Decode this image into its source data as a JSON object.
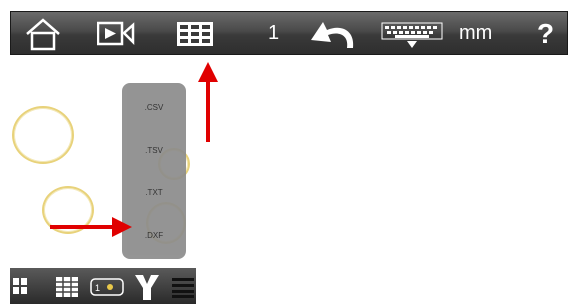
{
  "toolbar": {
    "page_number": "1",
    "units": "mm",
    "help_label": "?"
  },
  "export_menu": {
    "items": [
      ".CSV",
      ".TSV",
      ".TXT",
      ".DXF"
    ]
  },
  "colors": {
    "toolbar_bg": "#3a3a3a",
    "arrow": "#e00000",
    "circle_stroke": "#e8d27a",
    "panel_bg": "#8c8c8c"
  },
  "icons": [
    "home-icon",
    "video-camera-icon",
    "table-icon",
    "undo-icon",
    "keyboard-icon",
    "help-icon"
  ]
}
